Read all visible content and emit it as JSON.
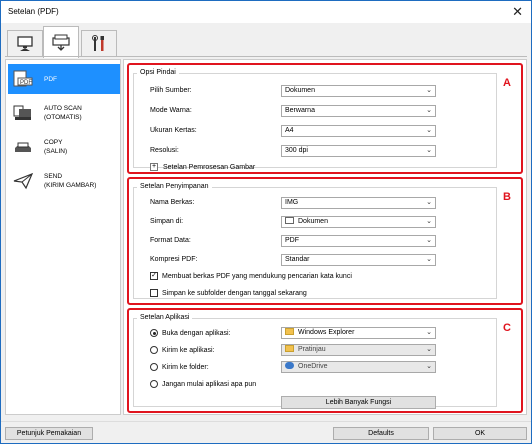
{
  "window": {
    "title": "Setelan (PDF)"
  },
  "tabs": [
    {
      "icon": "monitor-scan-icon"
    },
    {
      "icon": "scanner-icon"
    },
    {
      "icon": "tools-icon"
    }
  ],
  "sidebar": {
    "items": [
      {
        "label": "PDF",
        "icon": "pdf-document-icon",
        "selected": true
      },
      {
        "label": "AUTO SCAN\n(OTOMATIS)",
        "icon": "auto-scan-icon"
      },
      {
        "label": "COPY\n(SALIN)",
        "icon": "copy-icon"
      },
      {
        "label": "SEND\n(KIRIM GAMBAR)",
        "icon": "send-icon"
      }
    ]
  },
  "sections": {
    "a": {
      "letter": "A",
      "title": "Opsi Pindai",
      "rows": [
        {
          "label": "Pilih Sumber:",
          "value": "Dokumen"
        },
        {
          "label": "Mode Warna:",
          "value": "Berwarna"
        },
        {
          "label": "Ukuran Kertas:",
          "value": "A4"
        },
        {
          "label": "Resolusi:",
          "value": "300 dpi"
        }
      ],
      "expand_label": "Setelan Pemrosesan Gambar"
    },
    "b": {
      "letter": "B",
      "title": "Setelan Penyimpanan",
      "rows": [
        {
          "label": "Nama Berkas:",
          "value": "IMG"
        },
        {
          "label": "Simpan di:",
          "value": "Dokumen"
        },
        {
          "label": "Format Data:",
          "value": "PDF"
        },
        {
          "label": "Kompresi PDF:",
          "value": "Standar"
        }
      ],
      "checkbox1": {
        "label": "Membuat berkas PDF yang mendukung pencarian kata kunci",
        "checked": true
      },
      "checkbox2": {
        "label": "Simpan ke subfolder dengan tanggal sekarang",
        "checked": false
      }
    },
    "c": {
      "letter": "C",
      "title": "Setelan Aplikasi",
      "options": [
        {
          "label": "Buka dengan aplikasi:",
          "value": "Windows Explorer",
          "selected": true
        },
        {
          "label": "Kirim ke aplikasi:",
          "value": "Pratinjau",
          "selected": false
        },
        {
          "label": "Kirim ke folder:",
          "value": "OneDrive",
          "selected": false
        },
        {
          "label": "Jangan mulai aplikasi apa pun",
          "selected": false
        }
      ],
      "more_button": "Lebih Banyak Fungsi"
    }
  },
  "footer": {
    "help_button": "Petunjuk Pemakaian",
    "defaults_button": "Defaults",
    "ok_button": "OK"
  },
  "colors": {
    "accent": "#1e90ff",
    "highlight": "#e0141e",
    "window_border": "#1e6cc0"
  }
}
